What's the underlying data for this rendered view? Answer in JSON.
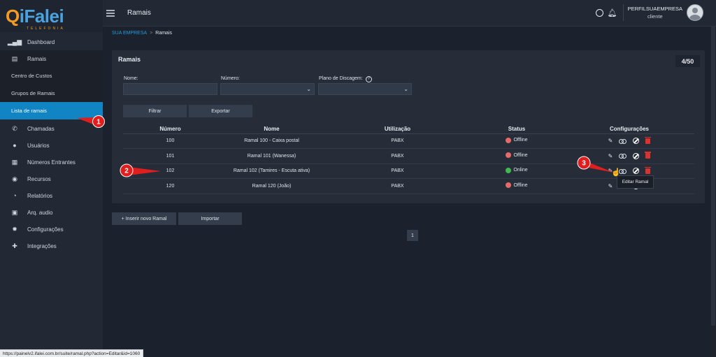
{
  "logo": {
    "text_main": "iFalei",
    "text_q": "Q",
    "text_sub": "TELEFONIA"
  },
  "sidebar": {
    "items": [
      {
        "label": "Dashboard",
        "icon": "chart-icon"
      },
      {
        "label": "Ramais",
        "icon": "address-book-icon"
      }
    ],
    "subitems": [
      {
        "label": "Centro de Custos"
      },
      {
        "label": "Grupos de Ramais"
      },
      {
        "label": "Lista de ramais",
        "selected": true
      }
    ],
    "items_after": [
      {
        "label": "Chamadas",
        "icon": "phone-icon"
      },
      {
        "label": "Usuários",
        "icon": "user-icon"
      },
      {
        "label": "Números Entrantes",
        "icon": "keypad-icon"
      },
      {
        "label": "Recursos",
        "icon": "database-icon"
      },
      {
        "label": "Relatórios",
        "icon": "pie-chart-icon"
      },
      {
        "label": "Arq. audio",
        "icon": "audio-file-icon"
      },
      {
        "label": "Configurações",
        "icon": "gear-icon"
      },
      {
        "label": "Integrações",
        "icon": "puzzle-icon"
      }
    ]
  },
  "topbar": {
    "title": "Ramais",
    "profile_name": "PERFILSUAEMPRESA",
    "profile_role": "cliente"
  },
  "breadcrumb": {
    "company": "SUA EMPRESA",
    "separator": ">",
    "current": "Ramais"
  },
  "card": {
    "title": "Ramais",
    "count": "4/50"
  },
  "filters": {
    "nome_label": "Nome:",
    "nome_value": "",
    "numero_label": "Número:",
    "numero_value": "",
    "plano_label": "Plano de Discagem:",
    "plano_value": "",
    "filtrar_button": "Filtrar",
    "exportar_button": "Exportar"
  },
  "table": {
    "headers": [
      "Número",
      "Nome",
      "Utilização",
      "Status",
      "Configurações"
    ],
    "rows": [
      {
        "numero": "100",
        "nome": "Ramal 100 - Caixa postal",
        "utilizacao": "PABX",
        "status": "Offline",
        "status_color": "#e66a6a"
      },
      {
        "numero": "101",
        "nome": "Ramal 101 (Wanessa)",
        "utilizacao": "PABX",
        "status": "Offline",
        "status_color": "#e66a6a"
      },
      {
        "numero": "102",
        "nome": "Ramal 102 (Tamires - Escuta ativa)",
        "utilizacao": "PABX",
        "status": "Online",
        "status_color": "#3fb950"
      },
      {
        "numero": "120",
        "nome": "Ramal 120 (João)",
        "utilizacao": "PABX",
        "status": "Offline",
        "status_color": "#e66a6a"
      }
    ]
  },
  "tooltip": {
    "text": "Editar Ramal"
  },
  "actions": {
    "inserir_button": "+ Inserir novo Ramal",
    "importar_button": "Importar"
  },
  "pagination": {
    "current_page": "1"
  },
  "status_url": "https://painelv2.ifalei.com.br/suite/ramal.php?action=Editar&id=1060",
  "markers": [
    "1",
    "2",
    "3"
  ]
}
